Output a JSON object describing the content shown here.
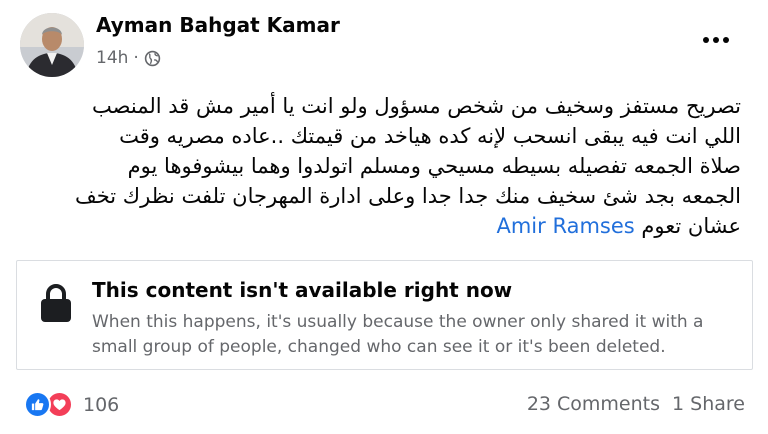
{
  "post": {
    "author": "Ayman Bahgat Kamar",
    "time": "14h",
    "separator": "·",
    "privacy_icon": "globe-icon",
    "menu_icon": "more-options-icon",
    "text_lines": [
      "تصريح مستفز وسخيف من شخص مسؤول ولو انت يا أمير مش قد المنصب",
      "اللي انت فيه يبقى انسحب لإنه كده هياخد من قيمتك ..عاده مصريه وقت",
      "صلاة الجمعه تفصيله بسيطه مسيحي ومسلم اتولدوا وهما بيشوفوها يوم",
      "الجمعه بجد شئ سخيف منك جدا جدا وعلى ادارة المهرجان تلفت نظرك تخف"
    ],
    "last_line_text": "عشان تعوم",
    "mention": "Amir Ramses"
  },
  "unavailable": {
    "icon": "lock-icon",
    "title": "This content isn't available right now",
    "description": "When this happens, it's usually because the owner only shared it with a small group of people, changed who can see it or it's been deleted."
  },
  "footer": {
    "reaction_icons": [
      "like-icon",
      "love-icon"
    ],
    "reaction_count": "106",
    "comments": "23 Comments",
    "shares": "1 Share"
  },
  "colors": {
    "like": "#1877f2",
    "love": "#f33e58",
    "mention": "#216fdb",
    "secondary_text": "#65676b"
  }
}
